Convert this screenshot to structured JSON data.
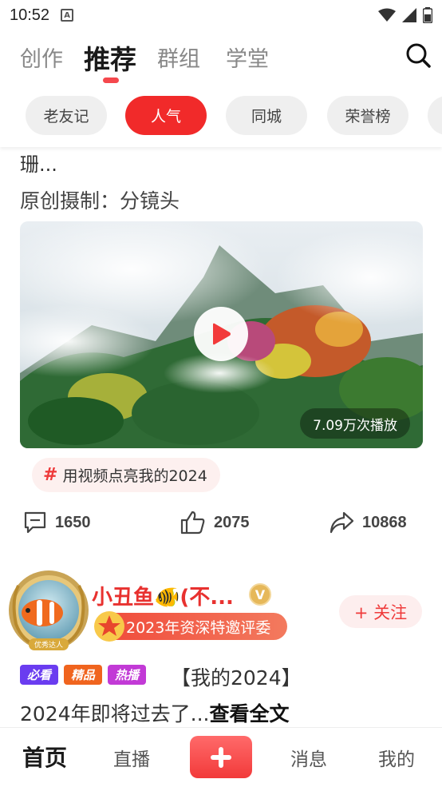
{
  "status_bar": {
    "time": "10:52",
    "notification_icon": "a-icon"
  },
  "top_nav": {
    "tabs": [
      {
        "label": "创作"
      },
      {
        "label": "推荐"
      },
      {
        "label": "群组"
      },
      {
        "label": "学堂"
      }
    ],
    "active_tab": "推荐",
    "search_icon": "search-icon",
    "accent_color": "#f5484d"
  },
  "chips": [
    {
      "label": "老友记"
    },
    {
      "label": "人气"
    },
    {
      "label": "同城"
    },
    {
      "label": "荣誉榜"
    }
  ],
  "post1": {
    "truncated_text": "珊...",
    "title": "原创摄制：分镜头",
    "play_count": "7.09万次播放",
    "topic_tag": "用视频点亮我的2024",
    "comments": "1650",
    "likes": "2075",
    "shares": "10868"
  },
  "post2": {
    "author_name": "小丑鱼🐠(不...",
    "verified_badge": "V",
    "avatar_badge": "优秀达人",
    "award_label": "2023年资深特邀评委",
    "follow_label": "+ 关注",
    "tags": [
      {
        "label": "必看",
        "color": "#6a3cf0"
      },
      {
        "label": "精品",
        "color": "#f0641e"
      },
      {
        "label": "热播",
        "color": "#c23ad6"
      }
    ],
    "headline": "【我的2024】",
    "summary": "2024年即将过去了...",
    "read_more": "查看全文"
  },
  "bottom_nav": {
    "items": [
      {
        "label": "首页"
      },
      {
        "label": "直播"
      },
      {
        "label": "消息"
      },
      {
        "label": "我的"
      }
    ],
    "plus_color": "#f23a3a"
  }
}
